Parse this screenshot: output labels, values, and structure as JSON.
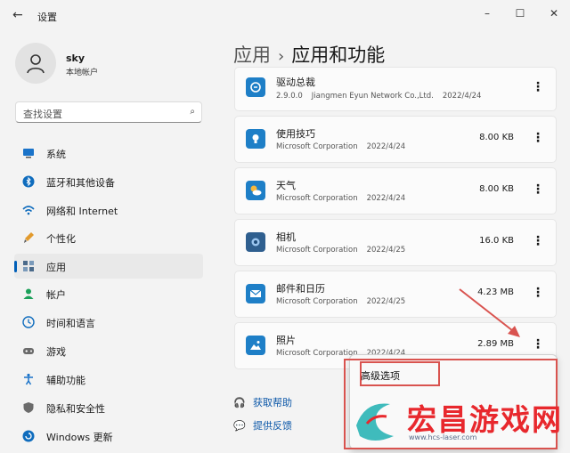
{
  "window": {
    "title": "设置",
    "back_icon": "arrow-left-icon",
    "controls": [
      "minimize-icon",
      "maximize-icon",
      "close-icon"
    ]
  },
  "user": {
    "name": "sky",
    "account_type": "本地帐户"
  },
  "search": {
    "placeholder": "查找设置"
  },
  "sidebar": {
    "items": [
      {
        "label": "系统",
        "icon": "monitor-icon",
        "color": "#1a73c9"
      },
      {
        "label": "蓝牙和其他设备",
        "icon": "bluetooth-icon",
        "color": "#0f6cbd"
      },
      {
        "label": "网络和 Internet",
        "icon": "wifi-icon",
        "color": "#0f6cbd"
      },
      {
        "label": "个性化",
        "icon": "brush-icon",
        "color": "#e29a2c"
      },
      {
        "label": "应用",
        "icon": "apps-icon",
        "color": "#4a6a8a",
        "active": true
      },
      {
        "label": "帐户",
        "icon": "person-icon",
        "color": "#1ca05a"
      },
      {
        "label": "时间和语言",
        "icon": "globe-clock-icon",
        "color": "#0f6cbd"
      },
      {
        "label": "游戏",
        "icon": "gamepad-icon",
        "color": "#6b6b6b"
      },
      {
        "label": "辅助功能",
        "icon": "accessibility-icon",
        "color": "#1a73c9"
      },
      {
        "label": "隐私和安全性",
        "icon": "shield-icon",
        "color": "#6b6b6b"
      },
      {
        "label": "Windows 更新",
        "icon": "update-icon",
        "color": "#0f6cbd"
      }
    ]
  },
  "breadcrumb": {
    "parent": "应用",
    "separator": "›",
    "current": "应用和功能"
  },
  "apps": [
    {
      "name": "驱动总裁",
      "version": "2.9.0.0",
      "publisher": "Jiangmen Eyun Network Co.,Ltd.",
      "date": "2022/4/24",
      "size": "",
      "icon": "driver-app-icon",
      "color": "#1e7fc7"
    },
    {
      "name": "使用技巧",
      "version": "",
      "publisher": "Microsoft Corporation",
      "date": "2022/4/24",
      "size": "8.00 KB",
      "icon": "lightbulb-icon",
      "color": "#1e7fc7"
    },
    {
      "name": "天气",
      "version": "",
      "publisher": "Microsoft Corporation",
      "date": "2022/4/24",
      "size": "8.00 KB",
      "icon": "weather-icon",
      "color": "#1e7fc7"
    },
    {
      "name": "相机",
      "version": "",
      "publisher": "Microsoft Corporation",
      "date": "2022/4/25",
      "size": "16.0 KB",
      "icon": "camera-icon",
      "color": "#2f5f8f"
    },
    {
      "name": "邮件和日历",
      "version": "",
      "publisher": "Microsoft Corporation",
      "date": "2022/4/25",
      "size": "4.23 MB",
      "icon": "mail-icon",
      "color": "#1e7fc7"
    },
    {
      "name": "照片",
      "version": "",
      "publisher": "Microsoft Corporation",
      "date": "2022/4/24",
      "size": "2.89 MB",
      "icon": "photos-icon",
      "color": "#1e7fc7"
    }
  ],
  "links": {
    "help": "获取帮助",
    "feedback": "提供反馈"
  },
  "context_menu": {
    "advanced": "高级选项"
  },
  "watermark": {
    "brand": "宏昌游戏网",
    "url": "www.hcs-laser.com"
  },
  "colors": {
    "accent": "#005fb8",
    "annotation": "#d9534f",
    "watermark": "#e8282d"
  }
}
